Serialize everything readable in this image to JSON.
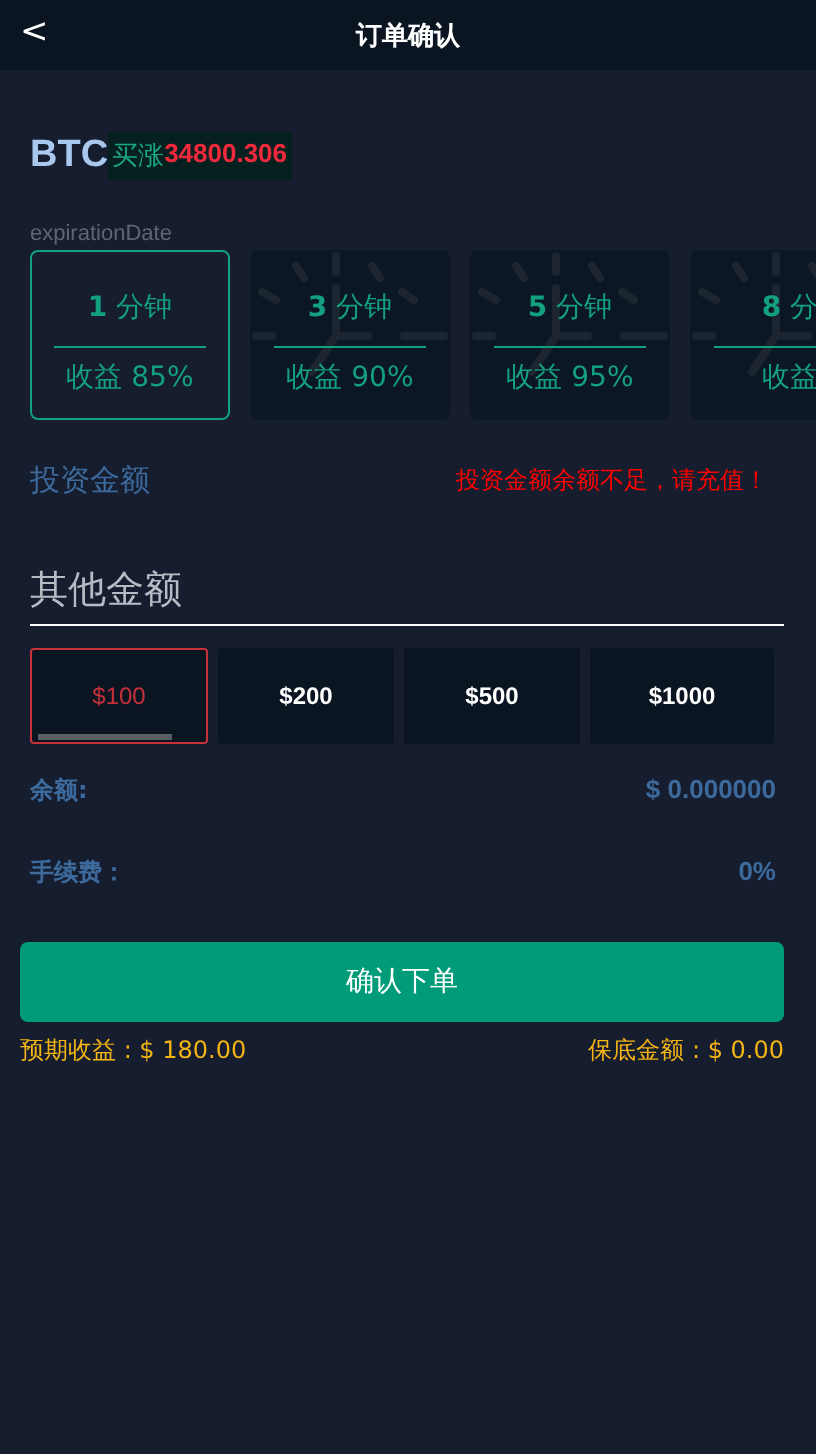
{
  "header": {
    "back": "<",
    "title": "订单确认"
  },
  "asset": {
    "symbol": "BTC",
    "direction": "买涨",
    "price": "34800.306"
  },
  "expiration": {
    "label": "expirationDate",
    "options": [
      {
        "number": "1",
        "unit": "分钟",
        "profit": "收益 85%",
        "selected": true
      },
      {
        "number": "3",
        "unit": "分钟",
        "profit": "收益 90%",
        "selected": false
      },
      {
        "number": "5",
        "unit": "分钟",
        "profit": "收益 95%",
        "selected": false
      },
      {
        "number": "8",
        "unit": "分",
        "profit": "收益",
        "selected": false
      }
    ]
  },
  "investment": {
    "label": "投资金额",
    "warning": "投资金额余额不足，请充值！",
    "placeholder": "其他金额",
    "amounts": [
      {
        "label": "$100",
        "selected": true
      },
      {
        "label": "$200",
        "selected": false
      },
      {
        "label": "$500",
        "selected": false
      },
      {
        "label": "$1000",
        "selected": false
      }
    ]
  },
  "details": [
    {
      "label": "余额:",
      "value": "$ 0.000000"
    },
    {
      "label": "手续费：",
      "value": "0%"
    }
  ],
  "submit": "确认下单",
  "footer": {
    "expected": "预期收益 : $ 180.00",
    "guaranteed": "保底金额 : $ 0.00"
  }
}
